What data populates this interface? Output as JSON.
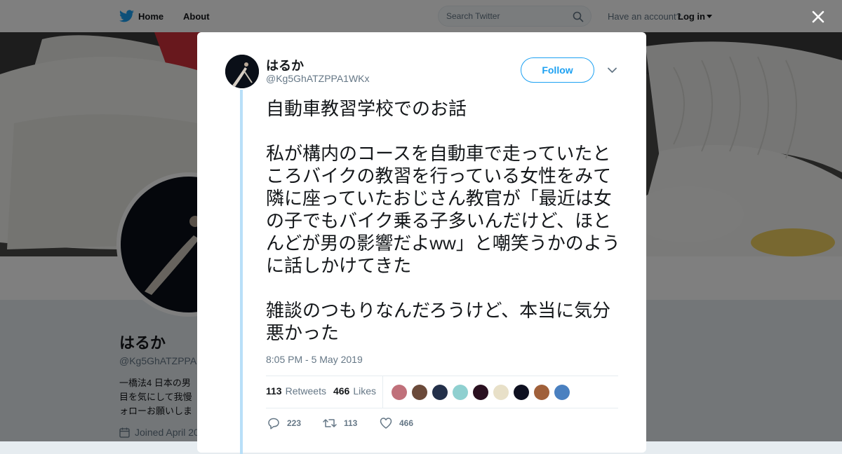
{
  "nav": {
    "home_label": "Home",
    "about_label": "About",
    "search_placeholder": "Search Twitter",
    "have_account": "Have an account?",
    "login_label": "Log in"
  },
  "profile": {
    "display_name": "はるか",
    "handle": "@Kg5GhATZPPA",
    "bio_lines": [
      "一橋法4 日本の男",
      "目を気にして我慢",
      "ォローお願いしま"
    ],
    "joined": "Joined April 20"
  },
  "tweet": {
    "display_name": "はるか",
    "handle": "@Kg5GhATZPPA1WKx",
    "follow_label": "Follow",
    "text": "自動車教習学校でのお話\n\n私が構内のコースを自動車で走っていたところバイクの教習を行っている女性をみて隣に座っていたおじさん教官が「最近は女の子でもバイク乗る子多いんだけど、ほとんどが男の影響だよww」と嘲笑うかのように話しかけてきた\n\n雑談のつもりなんだろうけど、本当に気分悪かった",
    "timestamp": "8:05 PM - 5 May 2019",
    "retweets_count": "113",
    "retweets_label": "Retweets",
    "likes_count": "466",
    "likes_label": "Likes",
    "actions": {
      "reply_count": "223",
      "retweet_count": "113",
      "like_count": "466"
    }
  },
  "likers": [
    {
      "name": "liker-1",
      "color": "#c0707a"
    },
    {
      "name": "liker-2",
      "color": "#6b4a3a"
    },
    {
      "name": "liker-3",
      "color": "#23304a"
    },
    {
      "name": "liker-4",
      "color": "#8fd0d0"
    },
    {
      "name": "liker-5",
      "color": "#2a1020"
    },
    {
      "name": "liker-6",
      "color": "#e8e0c8"
    },
    {
      "name": "liker-7",
      "color": "#0e1020"
    },
    {
      "name": "liker-8",
      "color": "#a0603a"
    },
    {
      "name": "liker-9",
      "color": "#4a80c0"
    }
  ],
  "colors": {
    "accent": "#1da1f2",
    "thread_line": "#b8dff8"
  }
}
